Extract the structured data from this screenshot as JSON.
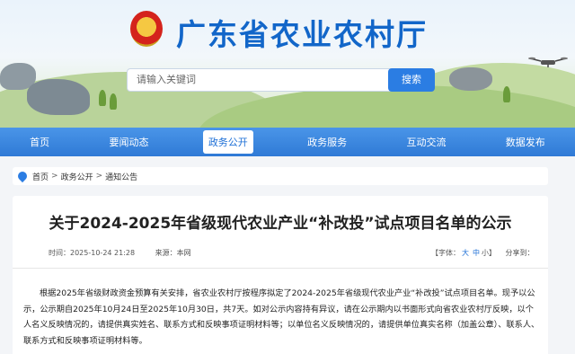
{
  "site": {
    "title": "广东省农业农村厅",
    "search_placeholder": "请输入关键词",
    "search_button": "搜索"
  },
  "nav": {
    "items": [
      {
        "label": "首页",
        "active": false
      },
      {
        "label": "要闻动态",
        "active": false
      },
      {
        "label": "政务公开",
        "active": true
      },
      {
        "label": "政务服务",
        "active": false
      },
      {
        "label": "互动交流",
        "active": false
      },
      {
        "label": "数据发布",
        "active": false
      }
    ]
  },
  "breadcrumb": [
    "首页",
    "政务公开",
    "通知公告"
  ],
  "article": {
    "title": "关于2024-2025年省级现代农业产业“补改投”试点项目名单的公示",
    "date_label": "时间：",
    "date": "2025-10-24 21:28",
    "source_label": "来源：",
    "source": "本网",
    "font_label": "【字体：",
    "font_large": "大",
    "font_medium": "中",
    "font_small": "小】",
    "share_label": "分享到：",
    "body": "根据2025年省级财政资金预算有关安排，省农业农村厅按程序拟定了2024-2025年省级现代农业产业“补改投”试点项目名单。现予以公示，公示期自2025年10月24日至2025年10月30日，共7天。如对公示内容持有异议，请在公示期内以书面形式向省农业农村厅反映，以个人名义反映情况的，请提供真实姓名、联系方式和反映事项证明材料等；以单位名义反映情况的，请提供单位真实名称（加盖公章）、联系人、联系方式和反映事项证明材料等。"
  }
}
